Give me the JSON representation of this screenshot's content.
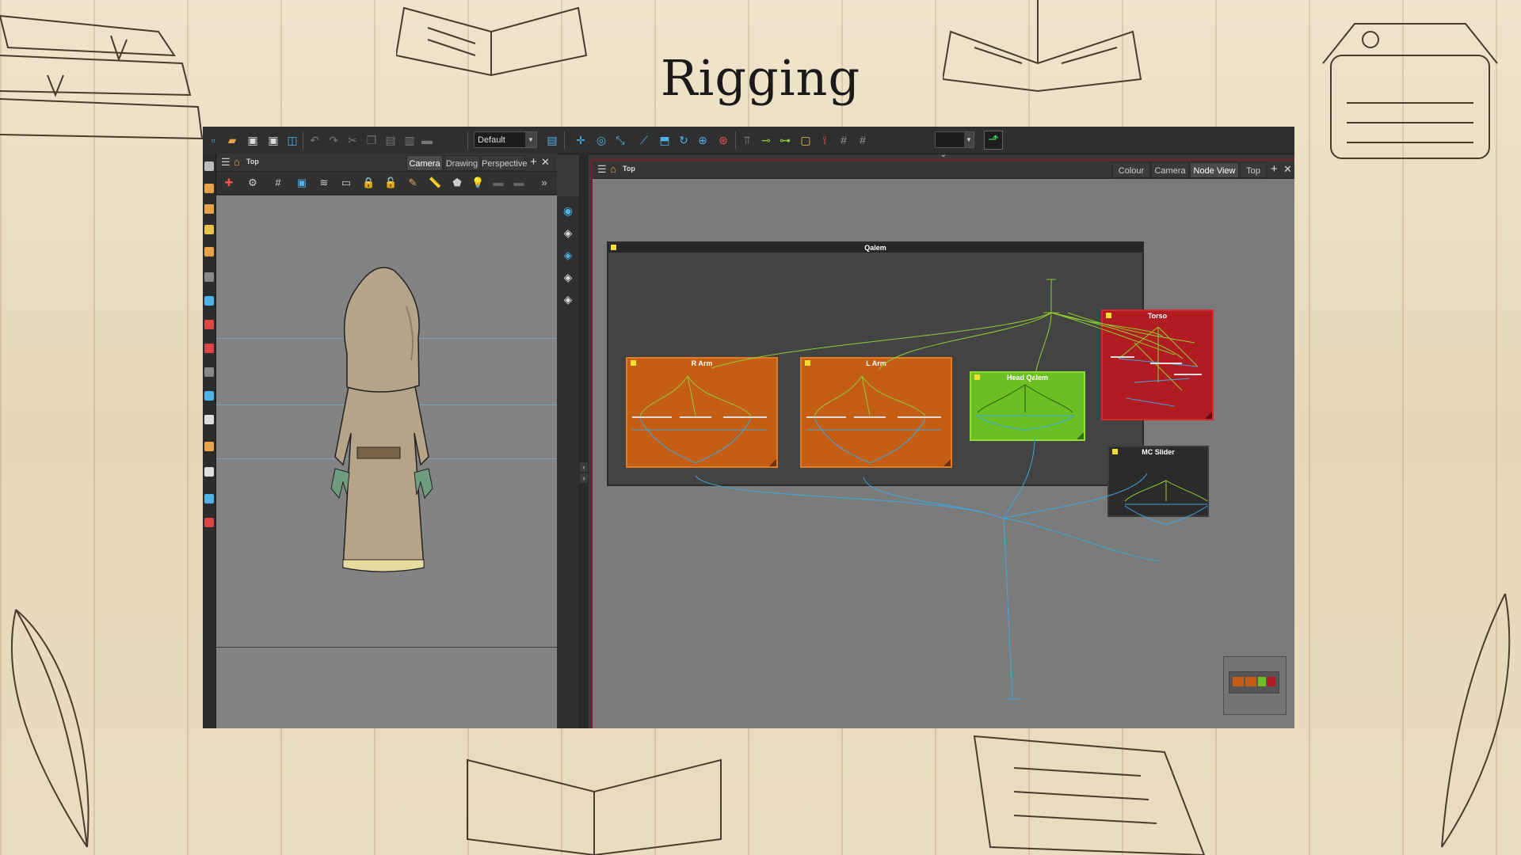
{
  "slide": {
    "title": "Rigging"
  },
  "toolbar": {
    "preset_value": "Default"
  },
  "camera_view": {
    "header_label": "Top",
    "tabs": [
      {
        "label": "Camera",
        "active": true
      },
      {
        "label": "Drawing",
        "active": false
      },
      {
        "label": "Perspective",
        "active": false
      }
    ]
  },
  "node_view": {
    "header_label": "Top",
    "tabs": [
      {
        "label": "Colour",
        "active": false
      },
      {
        "label": "Camera",
        "active": false
      },
      {
        "label": "Node View",
        "active": true
      },
      {
        "label": "Top",
        "active": false
      }
    ],
    "group": {
      "title": "Qalem"
    },
    "nodes": [
      {
        "title": "R Arm",
        "color": "#e06a12"
      },
      {
        "title": "L Arm",
        "color": "#e06a12"
      },
      {
        "title": "Head Qalem",
        "color": "#6cc81f"
      },
      {
        "title": "Torso",
        "color": "#c4141c"
      },
      {
        "title": "MC Slider",
        "color": "#2b2b2b"
      }
    ]
  },
  "colors": {
    "accent_blue": "#4fb3e8",
    "connection_green": "#8fce2f",
    "connection_blue": "#3aa8e0",
    "group_header": "#262626"
  }
}
